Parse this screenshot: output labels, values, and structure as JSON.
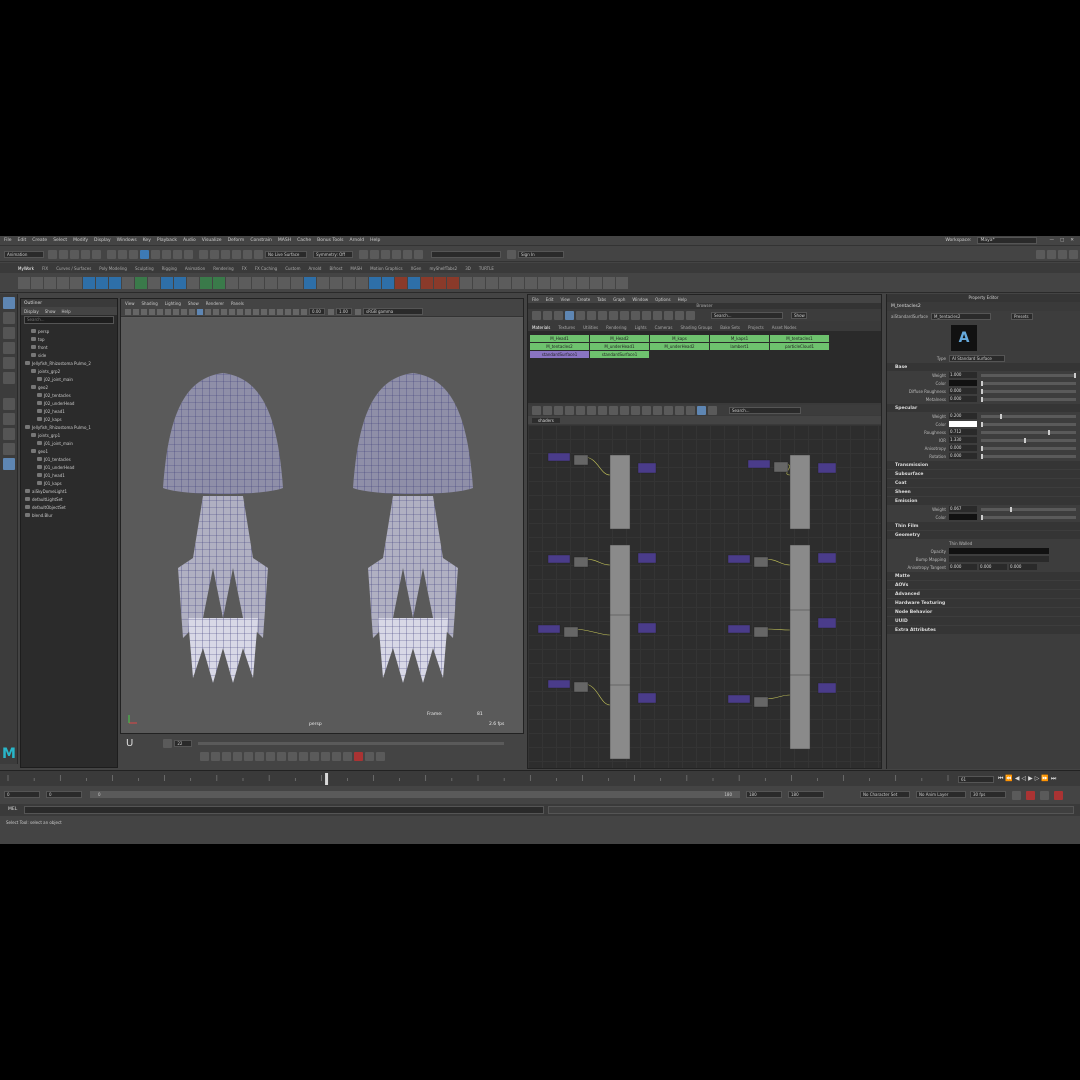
{
  "menu": [
    "File",
    "Edit",
    "Create",
    "Select",
    "Modify",
    "Display",
    "Windows",
    "Key",
    "Playback",
    "Audio",
    "Visualize",
    "Deform",
    "Constrain",
    "MASH",
    "Cache",
    "Bonus Tools",
    "Arnold",
    "Help"
  ],
  "workspace": {
    "label": "Workspace:",
    "value": "Maya*"
  },
  "status": {
    "mode": "Animation",
    "live_surface": "No Live Surface",
    "symmetry": "Symmetry: Off",
    "signin": "Sign In"
  },
  "shelf_tabs": [
    "MyWork",
    "FIX",
    "Curves / Surfaces",
    "Poly Modeling",
    "Sculpting",
    "Rigging",
    "Animation",
    "Rendering",
    "FX",
    "FX Caching",
    "Custom",
    "Arnold",
    "Bifrost",
    "MASH",
    "Motion Graphics",
    "XGen",
    "myShelfTabs2",
    "3D",
    "TURTLE"
  ],
  "outliner": {
    "title": "Outliner",
    "menu": [
      "Display",
      "Show",
      "Help"
    ],
    "search_placeholder": "Search...",
    "items": [
      {
        "label": "persp",
        "indent": 1
      },
      {
        "label": "top",
        "indent": 1
      },
      {
        "label": "front",
        "indent": 1
      },
      {
        "label": "side",
        "indent": 1
      },
      {
        "label": "Jellyfish_Rhizostoma Pulmo_2",
        "indent": 0
      },
      {
        "label": "joints_grp2",
        "indent": 1
      },
      {
        "label": "j02_joint_main",
        "indent": 2
      },
      {
        "label": "geo2",
        "indent": 1
      },
      {
        "label": "J02_tentacles",
        "indent": 2
      },
      {
        "label": "J02_underHead",
        "indent": 2
      },
      {
        "label": "J02_head1",
        "indent": 2
      },
      {
        "label": "J02_kaps",
        "indent": 2
      },
      {
        "label": "Jellyfish_Rhizostoma Pulmo_1",
        "indent": 0
      },
      {
        "label": "joints_grp1",
        "indent": 1
      },
      {
        "label": "j01_joint_main",
        "indent": 2
      },
      {
        "label": "geo1",
        "indent": 1
      },
      {
        "label": "J01_tentacles",
        "indent": 2
      },
      {
        "label": "J01_underHead",
        "indent": 2
      },
      {
        "label": "J01_head1",
        "indent": 2
      },
      {
        "label": "J01_kaps",
        "indent": 2
      },
      {
        "label": "aiSkyDomeLight1",
        "indent": 0
      },
      {
        "label": "defaultLightSet",
        "indent": 0
      },
      {
        "label": "defaultObjectSet",
        "indent": 0
      },
      {
        "label": "blend.Blur",
        "indent": 0
      }
    ]
  },
  "viewport": {
    "menu": [
      "View",
      "Shading",
      "Lighting",
      "Show",
      "Renderer",
      "Panels"
    ],
    "field_a": "0.00",
    "field_b": "1.00",
    "colorspace": "sRGB gamma",
    "camera": "persp",
    "frame_label": "Frame:",
    "frame_value": "81",
    "fps": "2.6 fps",
    "time_field": "22"
  },
  "hypershade": {
    "menu": [
      "File",
      "Edit",
      "View",
      "Create",
      "Tabs",
      "Graph",
      "Window",
      "Options",
      "Help"
    ],
    "browser_title": "Browser",
    "search_placeholder": "Search...",
    "show_label": "Show",
    "tabs": [
      "Materials",
      "Textures",
      "Utilities",
      "Rendering",
      "Lights",
      "Cameras",
      "Shading Groups",
      "Bake Sets",
      "Projects",
      "Asset Nodes"
    ],
    "materials": [
      {
        "label": "M_Head1",
        "color": "green"
      },
      {
        "label": "M_Head2",
        "color": "green"
      },
      {
        "label": "M_kaps",
        "color": "green"
      },
      {
        "label": "M_kaps1",
        "color": "green"
      },
      {
        "label": "M_tentacles1",
        "color": "green"
      },
      {
        "label": "M_tentacles2",
        "color": "green"
      },
      {
        "label": "M_underHead1",
        "color": "green"
      },
      {
        "label": "M_underHead2",
        "color": "green"
      },
      {
        "label": "lambert1",
        "color": "green"
      },
      {
        "label": "particleCloud1",
        "color": "green"
      },
      {
        "label": "standardSurface1",
        "color": "purple"
      },
      {
        "label": "standardSurface1",
        "color": "green"
      }
    ],
    "node_tab": "shaders",
    "node_search": "Search..."
  },
  "attribute_editor": {
    "title": "Property Editor",
    "node_name": "M_tentacles2",
    "node_type": "aiStandardSurface",
    "node_field": "M_tentacles2",
    "focus_label": "Focus",
    "presets_label": "Presets",
    "type_label": "Type",
    "type_value": "AI Standard Surface",
    "sections": {
      "base": {
        "title": "Base",
        "rows": [
          {
            "label": "Weight",
            "value": "1.000",
            "pos": 0.98
          },
          {
            "label": "Color",
            "value": "",
            "pos": 0
          },
          {
            "label": "Diffuse Roughness",
            "value": "0.000",
            "pos": 0
          },
          {
            "label": "Metalness",
            "value": "0.000",
            "pos": 0
          }
        ]
      },
      "specular": {
        "title": "Specular",
        "rows": [
          {
            "label": "Weight",
            "value": "0.200",
            "pos": 0.2
          },
          {
            "label": "Color",
            "value": "",
            "pos": 0
          },
          {
            "label": "Roughness",
            "value": "0.712",
            "pos": 0.7
          },
          {
            "label": "IOR",
            "value": "1.330",
            "pos": 0.45
          },
          {
            "label": "Anisotropy",
            "value": "0.000",
            "pos": 0
          },
          {
            "label": "Rotation",
            "value": "0.000",
            "pos": 0
          }
        ]
      },
      "collapsed1": [
        "Transmission",
        "Subsurface",
        "Coat",
        "Sheen"
      ],
      "emission": {
        "title": "Emission",
        "rows": [
          {
            "label": "Weight",
            "value": "0.067",
            "pos": 0.3
          },
          {
            "label": "Color",
            "value": "",
            "pos": 0
          }
        ]
      },
      "thinfilm": "Thin Film",
      "geometry": {
        "title": "Geometry",
        "thin_walled": "Thin Walled",
        "opacity": "Opacity",
        "bump": "Bump Mapping",
        "aniso_label": "Anisotropy Tangent",
        "aniso": [
          "0.000",
          "0.000",
          "0.000"
        ]
      },
      "collapsed2": [
        "Matte",
        "AOVs",
        "Advanced",
        "Hardware Texturing",
        "Node Behavior",
        "UUID",
        "Extra Attributes"
      ]
    }
  },
  "timeline": {
    "current": "61",
    "start": "0",
    "end": "180"
  },
  "range": {
    "start_a": "0",
    "start_b": "0",
    "range_start": "0",
    "range_end": "180",
    "end_a": "180",
    "end_b": "180",
    "character_set": "No Character Set",
    "anim_layer": "No Anim Layer",
    "fps": "30 fps"
  },
  "cmdline": {
    "label": "MEL"
  },
  "helpline": "Select Tool: select an object"
}
